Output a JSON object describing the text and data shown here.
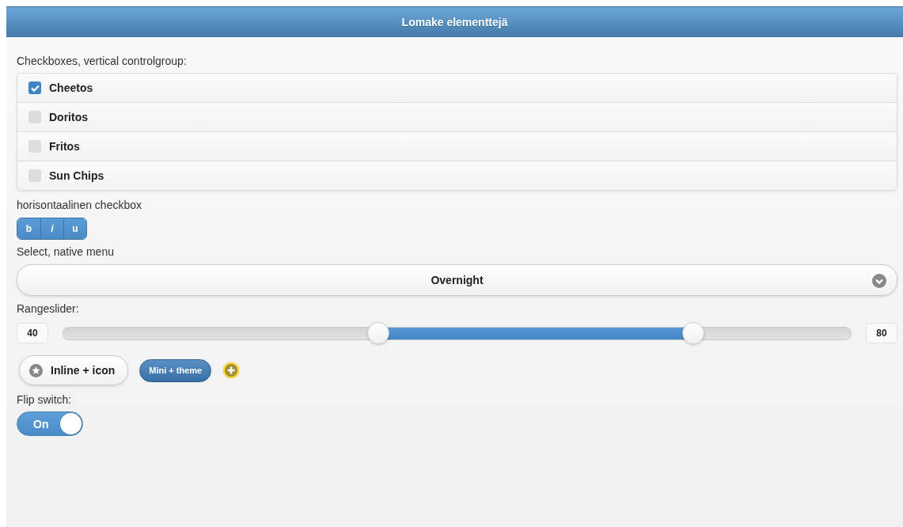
{
  "header": {
    "title": "Lomake elementtejä"
  },
  "checkbox_group": {
    "label": "Checkboxes, vertical controlgroup:",
    "items": [
      {
        "label": "Cheetos",
        "checked": true
      },
      {
        "label": "Doritos",
        "checked": false
      },
      {
        "label": "Fritos",
        "checked": false
      },
      {
        "label": "Sun Chips",
        "checked": false
      }
    ]
  },
  "horizontal_group": {
    "label": "horisontaalinen checkbox",
    "items": [
      {
        "label": "b",
        "checked": true
      },
      {
        "label": "i",
        "checked": true
      },
      {
        "label": "u",
        "checked": true
      }
    ]
  },
  "select": {
    "label": "Select, native menu",
    "value": "Overnight"
  },
  "range": {
    "label": "Rangeslider:",
    "low_value": "40",
    "high_value": "80",
    "handles": [
      {
        "level": 0.4
      },
      {
        "level": 0.8
      }
    ]
  },
  "buttons": [
    {
      "kind": "inline",
      "label": "Inline + icon"
    },
    {
      "kind": "mini",
      "label": "Mini + theme"
    },
    {
      "kind": "icon"
    }
  ],
  "flip_switch": {
    "label": "Flip switch:",
    "text": "On",
    "on": true
  }
}
